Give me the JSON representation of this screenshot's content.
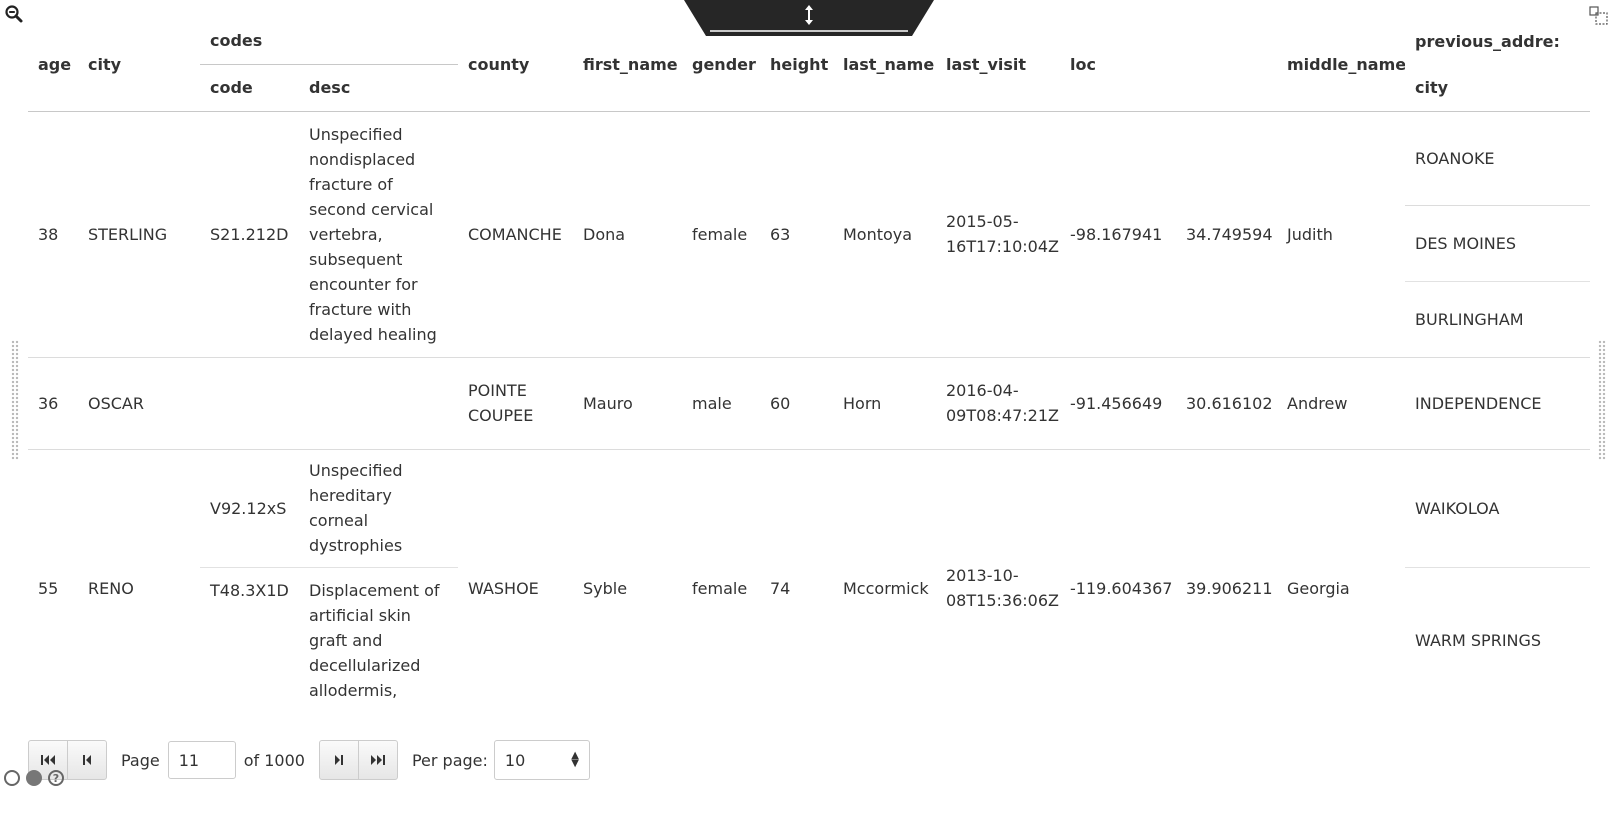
{
  "toolbar": {
    "zoom_icon": "magnifier-minus-icon",
    "expand_icon": "expand-icon",
    "resize_icon": "vertical-resize-icon"
  },
  "columns": {
    "age": "age",
    "city": "city",
    "codes": "codes",
    "code": "code",
    "desc": "desc",
    "county": "county",
    "first_name": "first_name",
    "gender": "gender",
    "height": "height",
    "last_name": "last_name",
    "last_visit": "last_visit",
    "loc": "loc",
    "middle_name": "middle_name",
    "previous_address": "previous_addre:",
    "previous_city": "city"
  },
  "rows": [
    {
      "age": "38",
      "city": "STERLING",
      "codes": [
        {
          "code": "S21.212D",
          "desc": "Unspecified nondisplaced fracture of second cervical vertebra, subsequent encounter for fracture with delayed healing"
        }
      ],
      "county": "COMANCHE",
      "first_name": "Dona",
      "gender": "female",
      "height": "63",
      "last_name": "Montoya",
      "last_visit": "2015-05-16T17:10:04Z",
      "loc_lon": "-98.167941",
      "loc_lat": "34.749594",
      "middle_name": "Judith",
      "previous_cities": [
        "ROANOKE",
        "DES MOINES",
        "BURLINGHAM"
      ]
    },
    {
      "age": "36",
      "city": "OSCAR",
      "codes": [],
      "county": "POINTE COUPEE",
      "first_name": "Mauro",
      "gender": "male",
      "height": "60",
      "last_name": "Horn",
      "last_visit": "2016-04-09T08:47:21Z",
      "loc_lon": "-91.456649",
      "loc_lat": "30.616102",
      "middle_name": "Andrew",
      "previous_cities": [
        "INDEPENDENCE"
      ]
    },
    {
      "age": "55",
      "city": "RENO",
      "codes": [
        {
          "code": "V92.12xS",
          "desc": "Unspecified hereditary corneal dystrophies"
        },
        {
          "code": "T48.3X1D",
          "desc": "Displacement of artificial skin graft and decellularized allodermis,"
        }
      ],
      "county": "WASHOE",
      "first_name": "Syble",
      "gender": "female",
      "height": "74",
      "last_name": "Mccormick",
      "last_visit": "2013-10-08T15:36:06Z",
      "loc_lon": "-119.604367",
      "loc_lat": "39.906211",
      "middle_name": "Georgia",
      "previous_cities": [
        "WAIKOLOA",
        "WARM SPRINGS"
      ]
    }
  ],
  "pager": {
    "page_label": "Page",
    "page_value": "11",
    "of_label": "of 1000",
    "per_page_label": "Per page:",
    "per_page_value": "10"
  },
  "footer_icons": [
    "empty-circle-icon",
    "filled-circle-icon",
    "help-icon"
  ]
}
